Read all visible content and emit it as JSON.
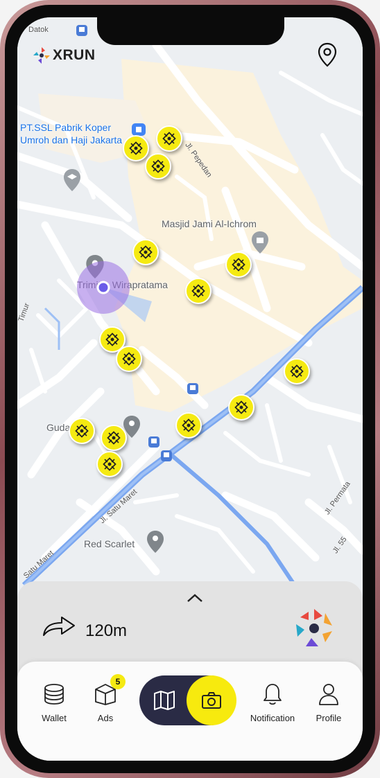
{
  "app": {
    "name": "XRUN"
  },
  "map": {
    "labels": {
      "poi_store": "PT.SSL Pabrik Koper\nUmroh dan Haji Jakarta",
      "mosque": "Masjid Jami Al-Ichrom",
      "trimitra": "Trimitra Wirapratama",
      "gudang": "Gudang G",
      "red_scarlet": "Red Scarlet",
      "datok": "Datok"
    },
    "streets": {
      "pepedan": "Jl. Pepedan",
      "satu_maret": "Jl. Satu Maret",
      "satu_maret_2": "Satu Maret",
      "permata": "Jl. Permata",
      "jl55": "Jl. 55",
      "timur": "Timur"
    }
  },
  "navigation": {
    "distance": "120m",
    "direction": "turn-right"
  },
  "bottom_nav": {
    "wallet_label": "Wallet",
    "ads_label": "Ads",
    "ads_badge": "5",
    "notification_label": "Notification",
    "profile_label": "Profile",
    "active_mode": "camera"
  },
  "colors": {
    "accent_yellow": "#f5ea12",
    "toggle_dark": "#2a2b45",
    "route_blue": "#7ba7f0",
    "user_marker": "#9b6fe4"
  }
}
